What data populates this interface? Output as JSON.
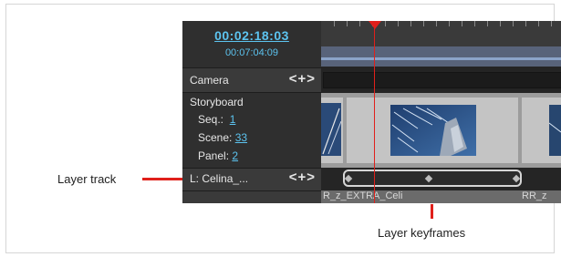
{
  "timecode": {
    "current": "00:02:18:03",
    "total": "00:07:04:09"
  },
  "camera_row": {
    "label": "Camera",
    "controls": "<+>"
  },
  "storyboard": {
    "title": "Storyboard",
    "seq_label": "Seq.:",
    "seq_value": "1",
    "scene_label": "Scene:",
    "scene_value": "33",
    "panel_label": "Panel:",
    "panel_value": "2"
  },
  "layer_row": {
    "label": "L: Celina_...",
    "controls": "<+>"
  },
  "footer_track": {
    "left_text": "R_z_EXTRA_Celi",
    "right_text": "RR_z"
  },
  "callouts": {
    "layer_track": "Layer track",
    "layer_keyframes": "Layer keyframes"
  },
  "colors": {
    "accent_red": "#e0201b",
    "timecode_blue": "#5cc3ef"
  }
}
